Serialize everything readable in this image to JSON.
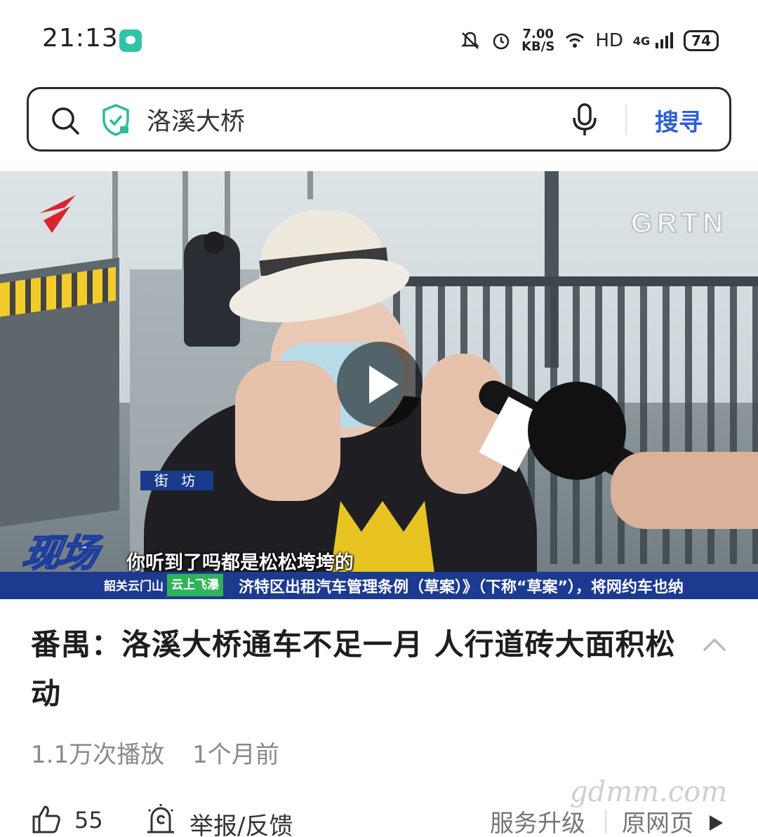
{
  "status_bar": {
    "time": "21:13",
    "speed_value": "7.00",
    "speed_unit": "KB/S",
    "hd": "HD",
    "network": "4G",
    "battery": "74"
  },
  "search": {
    "query": "洛溪大桥",
    "button_label": "搜寻"
  },
  "video": {
    "watermark": "GRTN",
    "location_tag": "街 坊",
    "subtitle": "你听到了吗都是松松垮垮的",
    "program_logo_text": "现场",
    "ticker_left": "韶关云门山",
    "ticker_green": "云上飞瀑",
    "ticker_text": "济特区出租汽车管理条例（草案）》（下称“草案”），将网约车也纳"
  },
  "article": {
    "title": "番禺：洛溪大桥通车不足一月 人行道砖大面积松动",
    "views": "1.1万次播放",
    "time_ago": "1个月前"
  },
  "actions": {
    "like_count": "55",
    "report_label": "举报/反馈",
    "service_upgrade_label": "服务升级",
    "original_page_label": "原网页"
  },
  "site_watermark": "gdmm.com",
  "colors": {
    "accent": "#2f5fd6",
    "shield": "#2fb89a",
    "ticker_bg": "#1c3a8f"
  }
}
